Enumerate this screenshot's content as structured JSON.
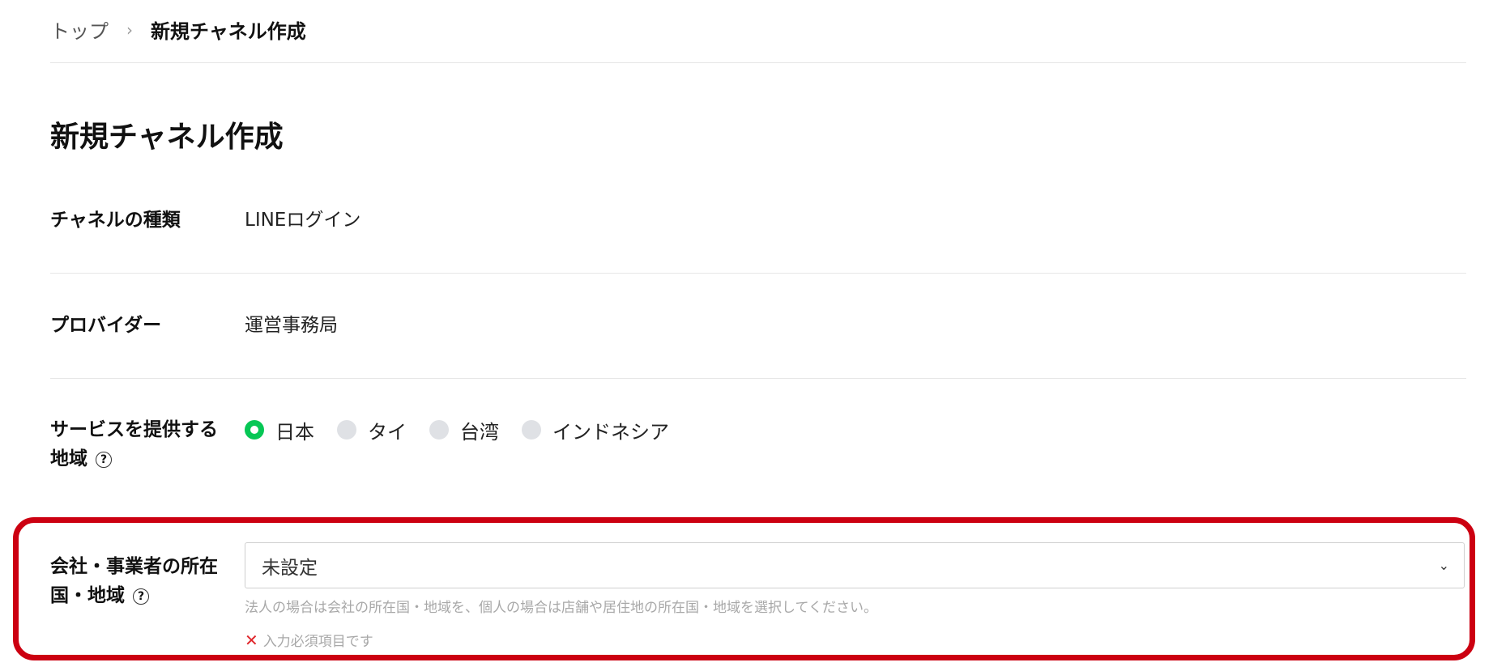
{
  "breadcrumb": {
    "home": "トップ",
    "separator": "›",
    "current": "新規チャネル作成"
  },
  "page_title": "新規チャネル作成",
  "channel_type": {
    "label": "チャネルの種類",
    "value": "LINEログイン"
  },
  "provider": {
    "label": "プロバイダー",
    "value": "運営事務局"
  },
  "service_region": {
    "label_line1": "サービスを提供する",
    "label_line2": "地域",
    "help": "?",
    "options": [
      {
        "label": "日本",
        "checked": true
      },
      {
        "label": "タイ",
        "checked": false
      },
      {
        "label": "台湾",
        "checked": false
      },
      {
        "label": "インドネシア",
        "checked": false
      }
    ]
  },
  "company_location": {
    "label_line1": "会社・事業者の所在",
    "label_line2": "国・地域",
    "help": "?",
    "selected": "未設定",
    "chevron": "⌄",
    "hint": "法人の場合は会社の所在国・地域を、個人の場合は店舗や居住地の所在国・地域を選択してください。",
    "error_icon": "✕",
    "error": "入力必須項目です"
  },
  "colors": {
    "accent": "#06c755",
    "highlight": "#cc0011",
    "error": "#e0262b"
  }
}
